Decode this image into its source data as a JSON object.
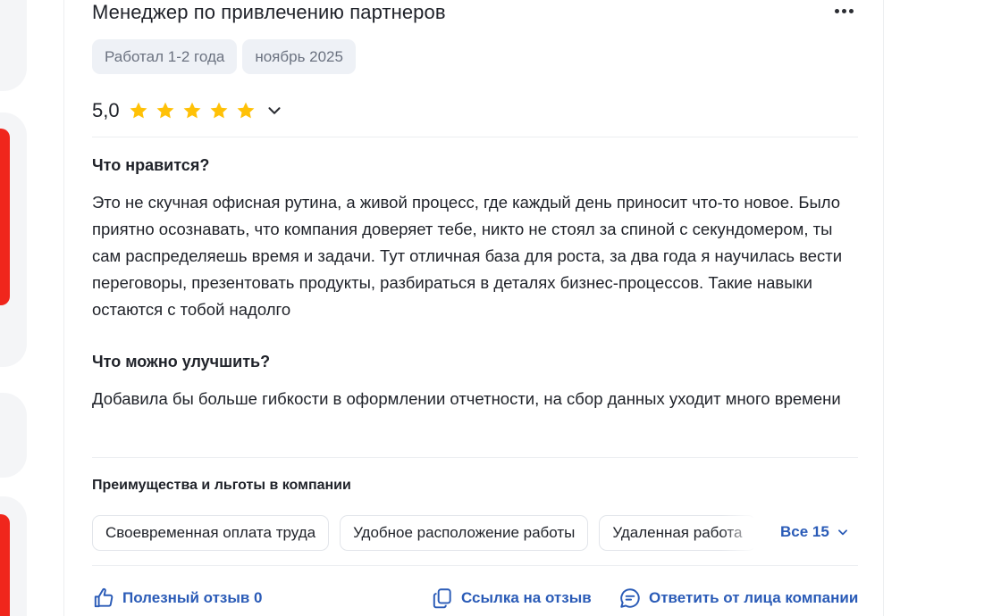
{
  "review": {
    "title": "Менеджер по привлечению партнеров",
    "tags": [
      "Работал 1-2 года",
      "ноябрь 2025"
    ],
    "rating": {
      "value": "5,0",
      "stars": 5,
      "max": 5,
      "star_color": "#ffc107"
    },
    "likes_heading": "Что нравится?",
    "likes_text": "Это не скучная офисная рутина, а живой процесс, где каждый день приносит что-то новое. Было приятно осознавать, что компания доверяет тебе, никто не стоял за спиной с секундомером, ты сам распределяешь время и задачи. Тут отличная база для роста, за два года я научилась вести переговоры, презентовать продукты, разбираться в деталях бизнес-процессов. Такие навыки остаются с тобой надолго",
    "improve_heading": "Что можно улучшить?",
    "improve_text": "Добавила бы больше гибкости в оформлении отчетности, на сбор данных уходит много времени",
    "benefits_heading": "Преимущества и льготы в компании",
    "benefits": [
      "Своевременная оплата труда",
      "Удобное расположение работы",
      "Удаленная работа"
    ],
    "all_label": "Все 15",
    "actions": {
      "helpful": "Полезный отзыв 0",
      "link": "Ссылка на отзыв",
      "reply": "Ответить от лица компании"
    }
  },
  "colors": {
    "link": "#2a5bb7",
    "accent_red": "#f0261c",
    "tag_bg": "#eef1f6"
  },
  "icons": [
    "more-dots-icon",
    "star-icon",
    "chevron-down-icon",
    "thumbs-up-icon",
    "copy-link-icon",
    "chat-bubble-icon"
  ]
}
